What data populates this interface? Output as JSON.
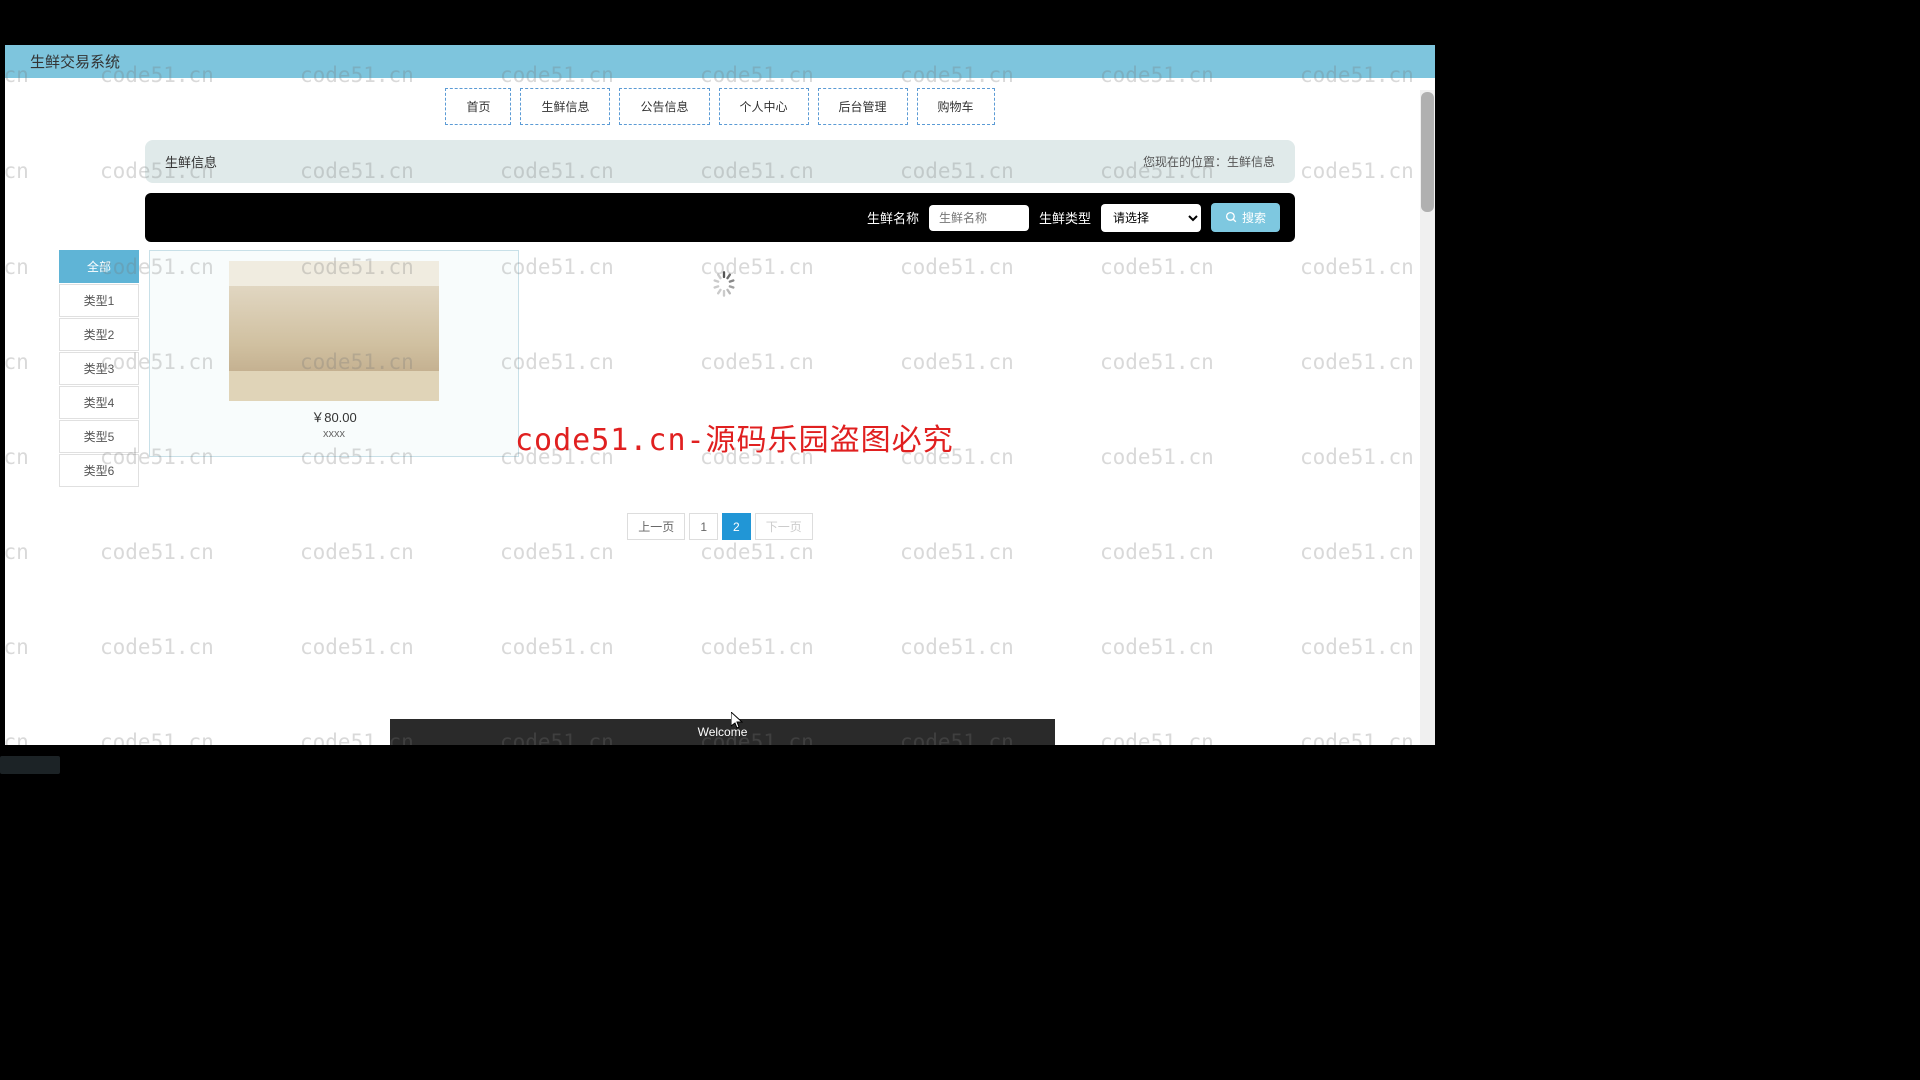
{
  "header": {
    "title": "生鲜交易系统"
  },
  "nav": {
    "items": [
      "首页",
      "生鲜信息",
      "公告信息",
      "个人中心",
      "后台管理",
      "购物车"
    ]
  },
  "breadcrumb": {
    "title": "生鲜信息",
    "location_label": "您现在的位置：",
    "location_value": "生鲜信息"
  },
  "search": {
    "name_label": "生鲜名称",
    "name_placeholder": "生鲜名称",
    "type_label": "生鲜类型",
    "type_placeholder": "请选择",
    "button": "搜索"
  },
  "sidebar": {
    "items": [
      "全部",
      "类型1",
      "类型2",
      "类型3",
      "类型4",
      "类型5",
      "类型6"
    ],
    "active_index": 0
  },
  "product": {
    "price": "￥80.00",
    "name": "xxxx"
  },
  "pagination": {
    "prev": "上一页",
    "next": "下一页",
    "pages": [
      "1",
      "2"
    ],
    "active": "2"
  },
  "watermark": "code51.cn",
  "red_banner": "code51.cn-源码乐园盗图必究",
  "footer": "Welcome"
}
